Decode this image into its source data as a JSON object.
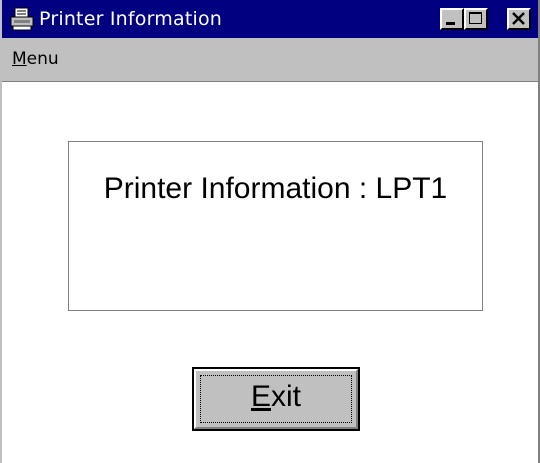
{
  "window": {
    "title": "Printer Information",
    "app_icon": "printer-icon",
    "controls": {
      "minimize_icon": "minimize-icon",
      "maximize_icon": "maximize-icon",
      "close_icon": "close-icon"
    }
  },
  "menubar": {
    "items": [
      {
        "mnemonic": "M",
        "rest": "enu"
      }
    ]
  },
  "main": {
    "info_text": "Printer Information : LPT1"
  },
  "actions": {
    "exit": {
      "mnemonic": "E",
      "rest": "xit"
    }
  },
  "colors": {
    "titlebar": "#000080",
    "face": "#c0c0c0",
    "background": "#ffffff"
  }
}
